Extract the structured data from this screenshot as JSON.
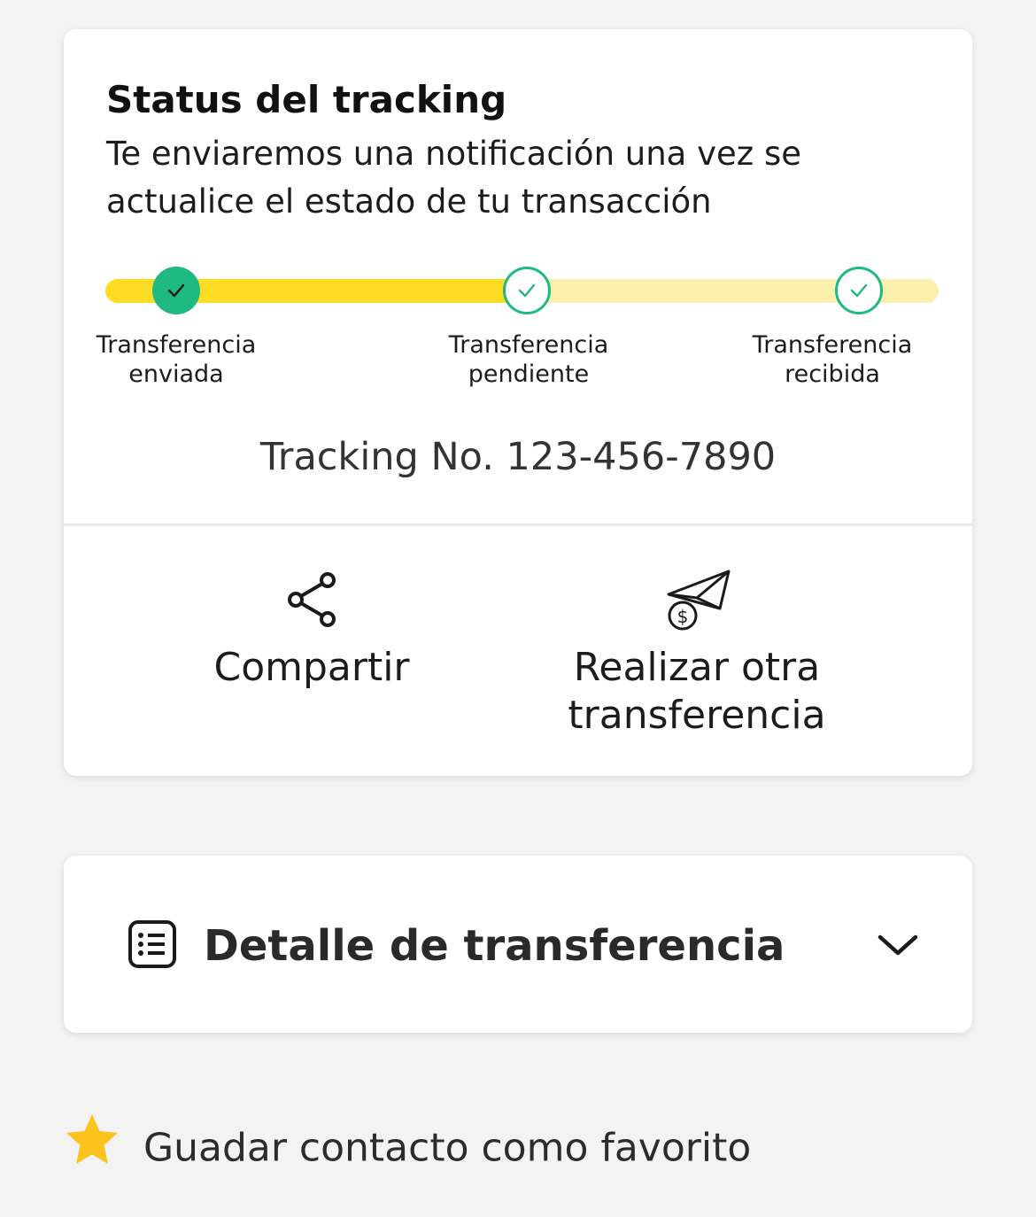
{
  "tracking": {
    "title": "Status del tracking",
    "subtitle": "Te enviaremos una notificación una vez se actualice el estado de tu transacción",
    "progress_fraction": 0.5,
    "steps": [
      {
        "line1": "Transferencia",
        "line2": "enviada",
        "state": "done"
      },
      {
        "line1": "Transferencia",
        "line2": "pendiente",
        "state": "pending"
      },
      {
        "line1": "Transferencia",
        "line2": "recibida",
        "state": "pending"
      }
    ],
    "tracking_number": "Tracking No. 123-456-7890"
  },
  "actions": {
    "share_label": "Compartir",
    "share_icon": "share-icon",
    "transfer_label_line1": "Realizar otra",
    "transfer_label_line2": "transferencia",
    "transfer_icon": "paper-plane-money-icon"
  },
  "detail": {
    "title": "Detalle de transferencia",
    "icon": "list-icon",
    "toggle_icon": "chevron-down-icon"
  },
  "favorite": {
    "label": "Guadar contacto como favorito",
    "icon": "star-icon"
  },
  "colors": {
    "accent_yellow": "#fddc23",
    "track_light": "#fbefad",
    "success_green": "#1fba82",
    "star": "#fcc31d"
  }
}
